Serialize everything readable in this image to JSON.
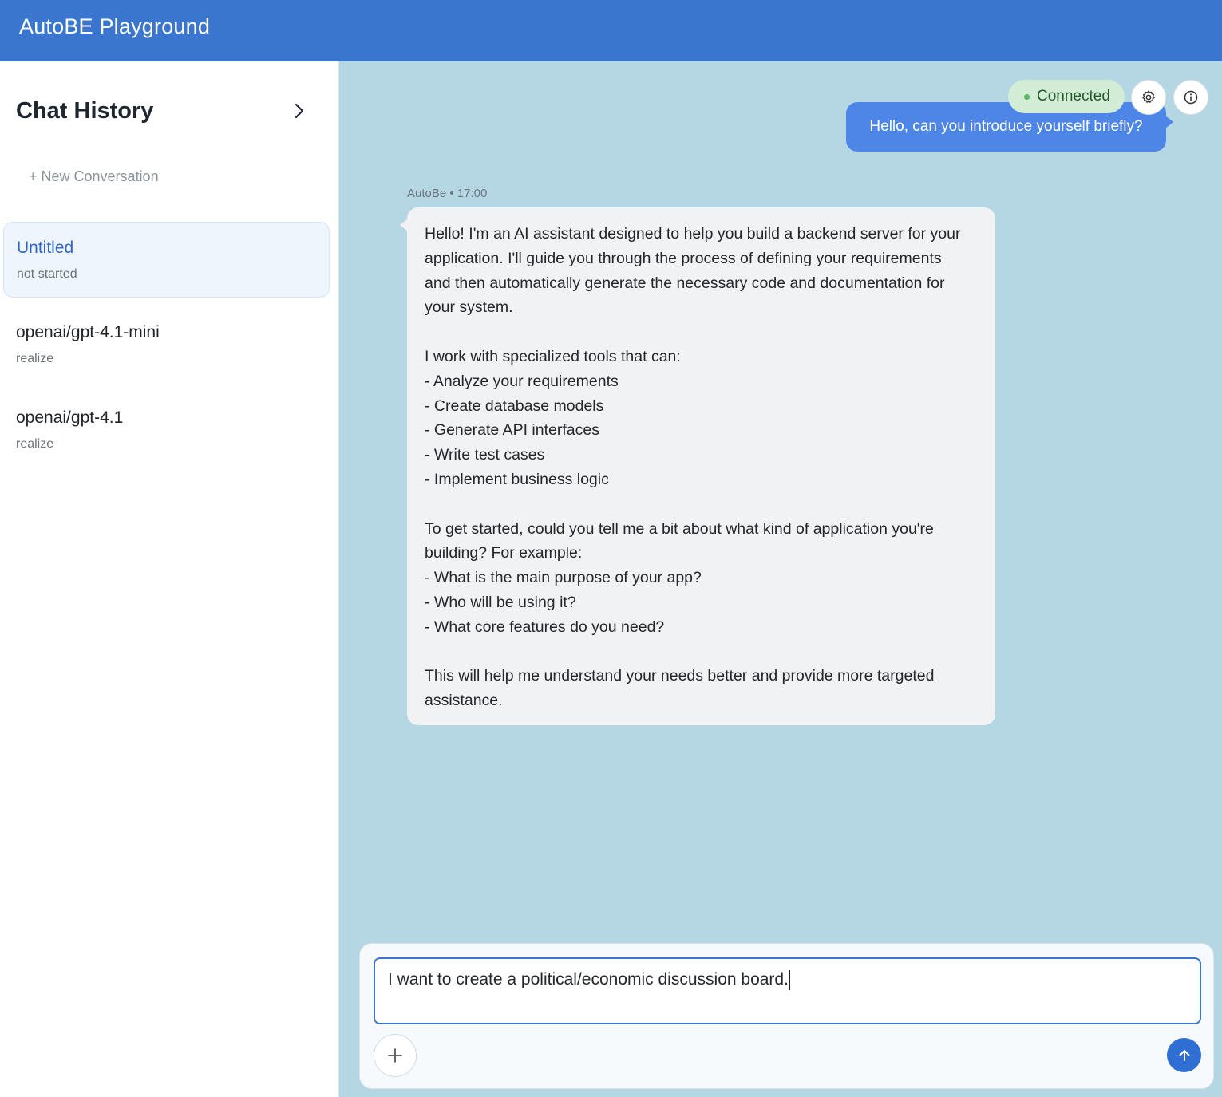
{
  "app": {
    "title": "AutoBE Playground"
  },
  "sidebar": {
    "title": "Chat History",
    "new_conversation": "+ New Conversation",
    "conversations": [
      {
        "name": "Untitled",
        "status": "not started",
        "active": true
      },
      {
        "name": "openai/gpt-4.1-mini",
        "status": "realize",
        "active": false
      },
      {
        "name": "openai/gpt-4.1",
        "status": "realize",
        "active": false
      }
    ]
  },
  "chat": {
    "connection_status": "Connected",
    "user_message": "Hello, can you introduce yourself briefly?",
    "assistant": {
      "meta": "AutoBe • 17:00",
      "message": "Hello! I'm an AI assistant designed to help you build a backend server for your\napplication. I'll guide you through the process of defining your requirements\nand then automatically generate the necessary code and documentation for\nyour system.\n\nI work with specialized tools that can:\n- Analyze your requirements\n- Create database models\n- Generate API interfaces\n- Write test cases\n- Implement business logic\n\nTo get started, could you tell me a bit about what kind of application you're\nbuilding? For example:\n- What is the main purpose of your app?\n- Who will be using it?\n- What core features do you need?\n\nThis will help me understand your needs better and provide more targeted\nassistance."
    }
  },
  "composer": {
    "input_value": "I want to create a political/economic discussion board."
  },
  "icons": {
    "expand": "chevron-right-icon",
    "settings": "gear-icon",
    "info": "info-icon",
    "attach": "plus-icon",
    "send": "arrow-up-icon"
  },
  "colors": {
    "header": "#3a76ce",
    "chat_background": "#b5d7e3",
    "user_bubble": "#4e86e8",
    "assistant_bubble": "#f1f2f4",
    "connected_pill": "#d2ecd5",
    "send_button": "#2f6ed3"
  }
}
